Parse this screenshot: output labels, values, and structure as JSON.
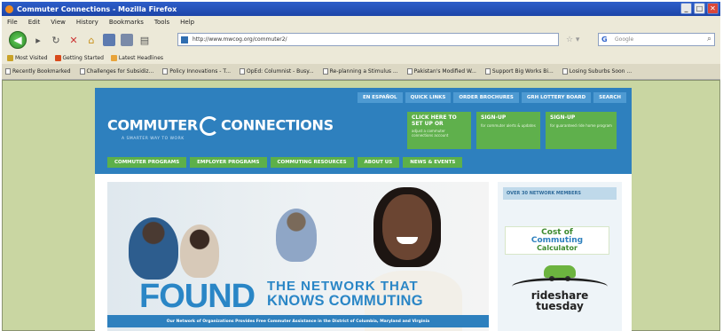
{
  "window": {
    "title": "Commuter Connections - Mozilla Firefox",
    "controls": [
      "_",
      "□",
      "✕"
    ]
  },
  "menu": [
    "File",
    "Edit",
    "View",
    "History",
    "Bookmarks",
    "Tools",
    "Help"
  ],
  "address": {
    "url": "http://www.mwcog.org/commuter2/",
    "search_placeholder": "Google"
  },
  "bookmarks": [
    {
      "label": "Most Visited",
      "color": "#c9a227"
    },
    {
      "label": "Getting Started",
      "color": "#d84a1b"
    },
    {
      "label": "Latest Headlines",
      "color": "#e8a43a"
    }
  ],
  "tabs": [
    "Recently Bookmarked",
    "Challenges for Subsidiz...",
    "Policy Innovations - T...",
    "OpEd: Columnist - Busy...",
    "Re-planning a Stimulus ...",
    "Pakistan's Modified W...",
    "Support Big Works Bi...",
    "Losing Suburbs Soon ..."
  ],
  "site": {
    "util_nav": [
      "EN ESPAÑOL",
      "QUICK LINKS",
      "ORDER BROCHURES",
      "GRH LOTTERY BOARD",
      "SEARCH"
    ],
    "logo_left": "COMMUTER",
    "logo_right": "CONNECTIONS",
    "tagline": "A SMARTER WAY TO WORK",
    "promos": [
      {
        "title": "CLICK HERE TO SET UP OR",
        "sub": "adjust a commuter connections account"
      },
      {
        "title": "SIGN-UP",
        "sub": "for commuter alerts & updates"
      },
      {
        "title": "SIGN-UP",
        "sub": "for guaranteed ride home program"
      }
    ],
    "main_nav": [
      "COMMUTER PROGRAMS",
      "EMPLOYER PROGRAMS",
      "COMMUTING RESOURCES",
      "ABOUT US",
      "NEWS & EVENTS"
    ],
    "hero": {
      "headline": "FOUND",
      "sub_line1": "THE NETWORK THAT",
      "sub_line2": "KNOWS COMMUTING",
      "caption": "Our Network of Organizations Provides Free Commuter Assistance in the District of Columbia, Maryland and Virginia"
    },
    "sidebar": {
      "header": "OVER 30 NETWORK MEMBERS",
      "calc_line1": "Cost of",
      "calc_line2": "Commuting",
      "calc_line3": "Calculator",
      "rideshare_line1": "rideshare",
      "rideshare_line2": "tuesday"
    }
  }
}
